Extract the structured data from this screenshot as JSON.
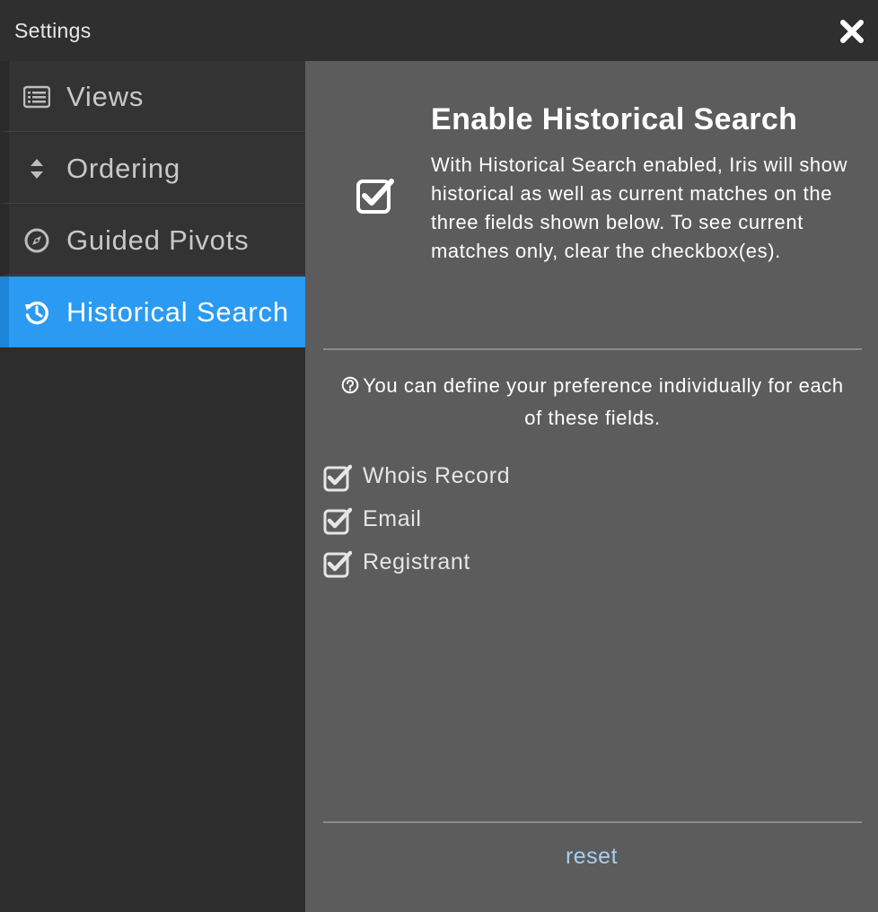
{
  "window": {
    "title": "Settings",
    "close_icon": "close-icon"
  },
  "sidebar": {
    "items": [
      {
        "label": "Views",
        "icon": "list-icon",
        "active": false
      },
      {
        "label": "Ordering",
        "icon": "sort-icon",
        "active": false
      },
      {
        "label": "Guided Pivots",
        "icon": "compass-icon",
        "active": false
      },
      {
        "label": "Historical Search",
        "icon": "history-icon",
        "active": true
      }
    ]
  },
  "main": {
    "title": "Enable Historical Search",
    "enabled": true,
    "description": "With Historical Search enabled, Iris will show historical as well as current matches on the three fields shown below. To see current matches only, clear the checkbox(es).",
    "hint": "You can define your preference individually for each of these fields.",
    "fields": [
      {
        "label": "Whois Record",
        "checked": true
      },
      {
        "label": "Email",
        "checked": true
      },
      {
        "label": "Registrant",
        "checked": true
      }
    ],
    "reset_label": "reset"
  },
  "colors": {
    "active_tab": "#2b9af3",
    "content_bg": "#5c5c5c",
    "sidebar_bg": "#333333",
    "link": "#a9cdec"
  }
}
